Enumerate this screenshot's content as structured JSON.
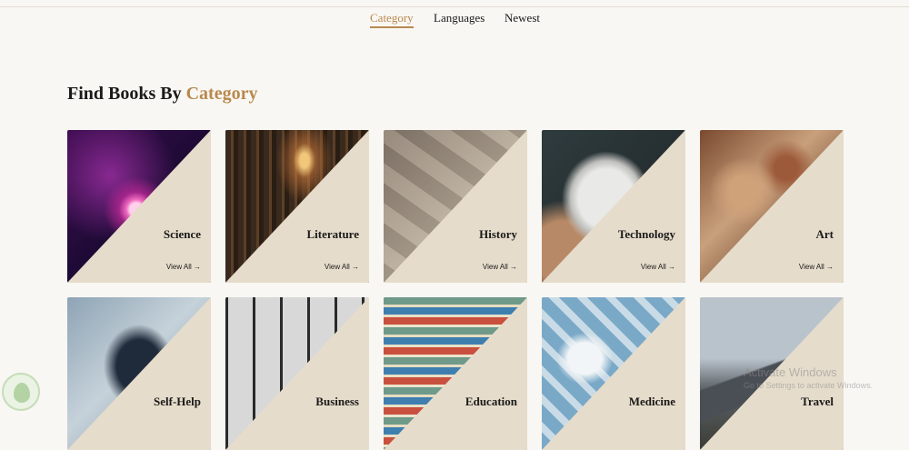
{
  "tabs": [
    {
      "label": "Category",
      "active": true
    },
    {
      "label": "Languages",
      "active": false
    },
    {
      "label": "Newest",
      "active": false
    }
  ],
  "heading": {
    "prefix": "Find Books By",
    "accent": "Category"
  },
  "categories": [
    {
      "label": "Science",
      "view": "View All →",
      "icon": "plasma-ball-photo"
    },
    {
      "label": "Literature",
      "view": "View All →",
      "icon": "library-photo"
    },
    {
      "label": "History",
      "view": "View All →",
      "icon": "old-maps-photo"
    },
    {
      "label": "Technology",
      "view": "View All →",
      "icon": "device-photo"
    },
    {
      "label": "Art",
      "view": "View All →",
      "icon": "fresco-photo"
    },
    {
      "label": "Self-Help",
      "icon": "backpack-photo"
    },
    {
      "label": "Business",
      "icon": "office-window-photo"
    },
    {
      "label": "Education",
      "icon": "book-stack-photo"
    },
    {
      "label": "Medicine",
      "icon": "pills-photo"
    },
    {
      "label": "Travel",
      "icon": "mountain-photo"
    }
  ],
  "watermark": {
    "line1": "Activate Windows",
    "line2": "Go to Settings to activate Windows."
  },
  "colors": {
    "accent": "#b8894f",
    "card_tint": "#e6dccb",
    "background": "#f9f7f3"
  }
}
